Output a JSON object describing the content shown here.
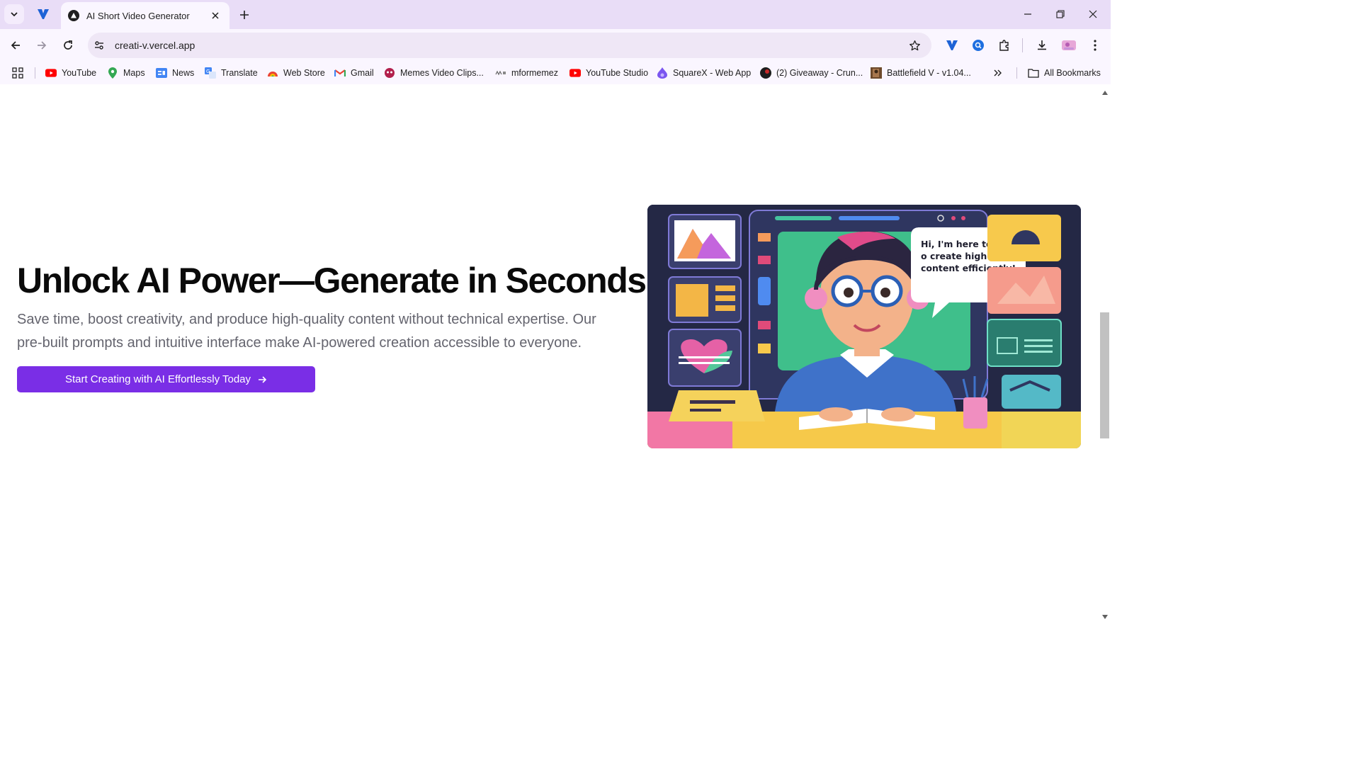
{
  "browser": {
    "tab": {
      "title": "AI Short Video Generator"
    },
    "url": "creati-v.vercel.app",
    "bookmarks": [
      {
        "label": "YouTube",
        "icon": "youtube-icon"
      },
      {
        "label": "Maps",
        "icon": "maps-icon"
      },
      {
        "label": "News",
        "icon": "news-icon"
      },
      {
        "label": "Translate",
        "icon": "translate-icon"
      },
      {
        "label": "Web Store",
        "icon": "webstore-icon"
      },
      {
        "label": "Gmail",
        "icon": "gmail-icon"
      },
      {
        "label": "Memes Video Clips...",
        "icon": "memes-icon"
      },
      {
        "label": "mformemez",
        "icon": "mformemez-icon"
      },
      {
        "label": "YouTube Studio",
        "icon": "youtube-studio-icon"
      },
      {
        "label": "SquareX - Web App",
        "icon": "squarex-icon"
      },
      {
        "label": "(2) Giveaway - Crun...",
        "icon": "giveaway-icon"
      },
      {
        "label": "Battlefield V - v1.04...",
        "icon": "battlefield-icon"
      }
    ],
    "all_bookmarks": "All Bookmarks",
    "colors": {
      "chrome": "#e9ddf7",
      "toolbar": "#faf6ff"
    }
  },
  "hero": {
    "title": "Unlock AI Power—Generate in Seconds",
    "description": "Save time, boost creativity, and produce high-quality content without technical expertise. Our pre-built prompts and intuitive interface make AI-powered creation accessible to everyone.",
    "cta_label": "Start Creating with AI Effortlessly Today",
    "image": {
      "speech_line1": "Hi, I'm here to help you",
      "speech_line2": "o create high-quality",
      "speech_line3": "content efficiently!"
    },
    "colors": {
      "accent": "#7a2ee6",
      "title": "#0a0a0a",
      "body": "#64646e"
    }
  }
}
